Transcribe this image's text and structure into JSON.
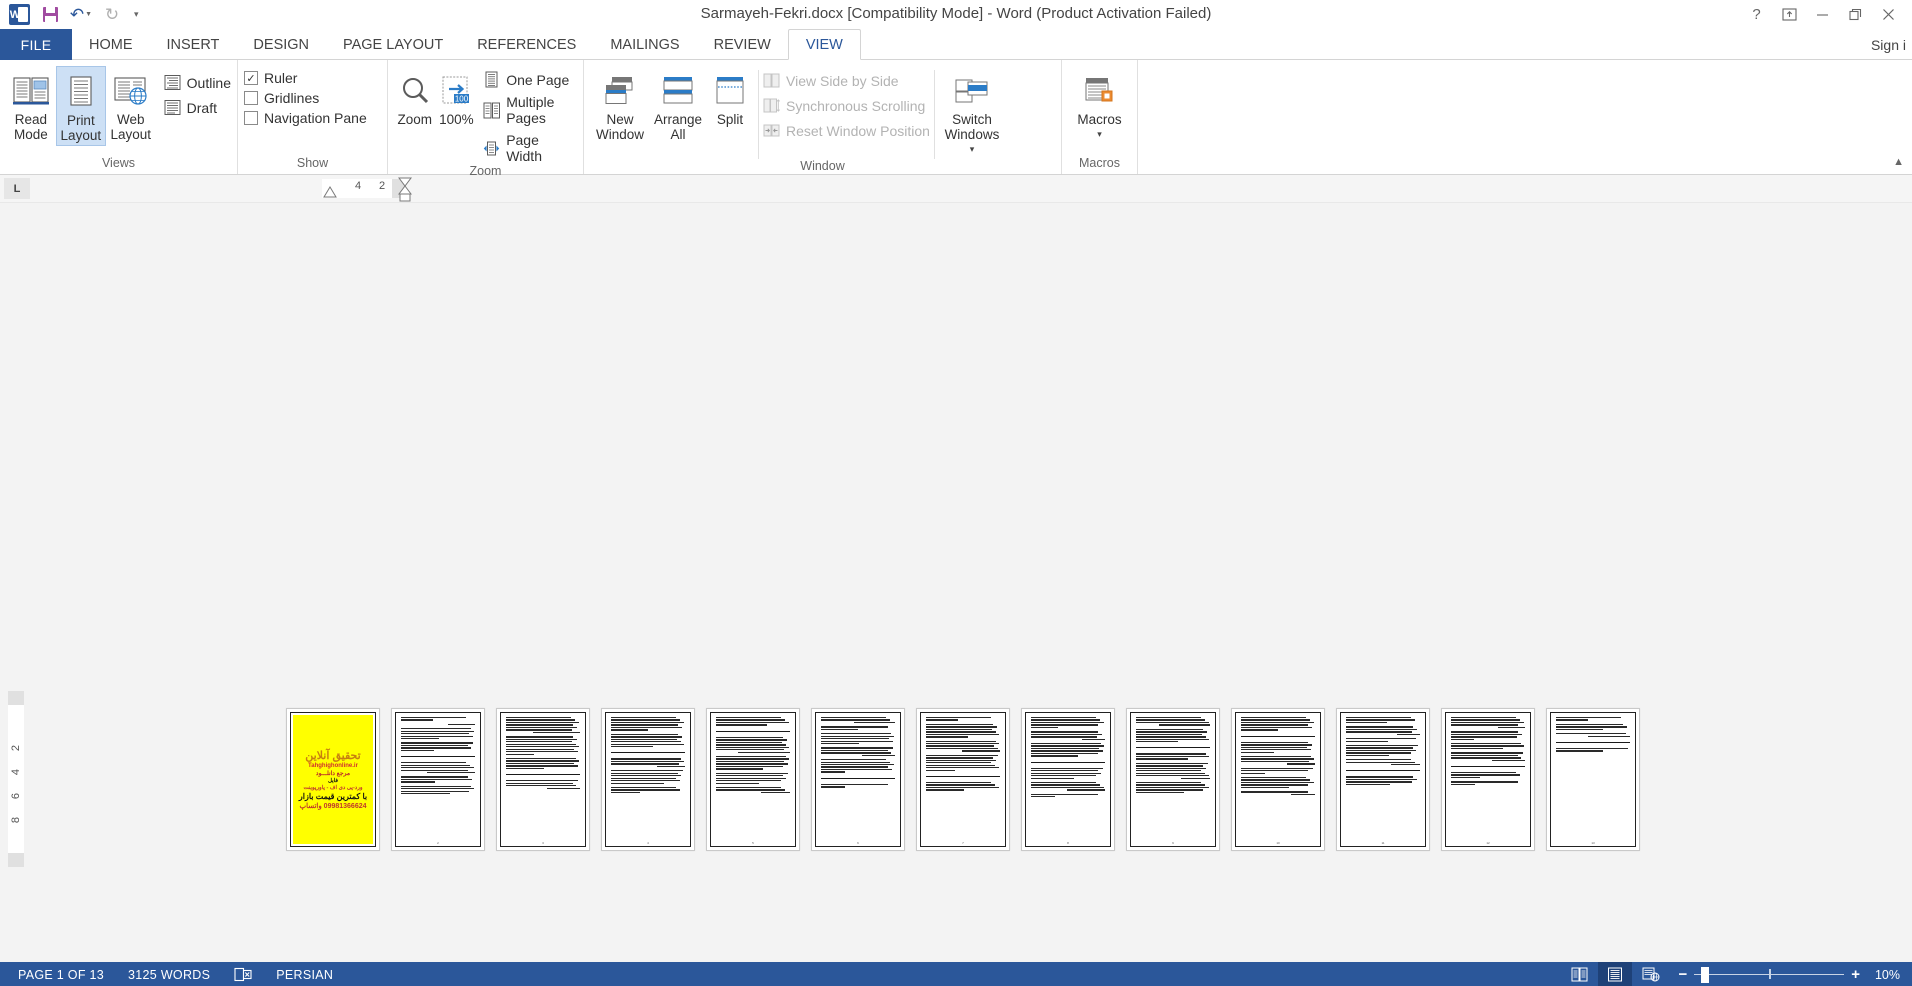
{
  "titlebar": {
    "app_icon": "word-logo-icon",
    "quick_access": [
      {
        "name": "save-button",
        "icon": "save-icon"
      },
      {
        "name": "undo-button",
        "icon": "undo-arrow-icon"
      },
      {
        "name": "redo-button",
        "icon": "redo-arrow-icon"
      },
      {
        "name": "customize-qat-button",
        "icon": "chevron-down-icon"
      }
    ],
    "title": "Sarmayeh-Fekri.docx [Compatibility Mode] - Word (Product Activation Failed)",
    "help_label": "?",
    "ribbon_display_label": "Ribbon Display Options",
    "minimize_label": "Minimize",
    "restore_label": "Restore Down",
    "close_label": "Close"
  },
  "tabs": {
    "file_label": "FILE",
    "items": [
      {
        "label": "HOME",
        "active": false
      },
      {
        "label": "INSERT",
        "active": false
      },
      {
        "label": "DESIGN",
        "active": false
      },
      {
        "label": "PAGE LAYOUT",
        "active": false
      },
      {
        "label": "REFERENCES",
        "active": false
      },
      {
        "label": "MAILINGS",
        "active": false
      },
      {
        "label": "REVIEW",
        "active": false
      },
      {
        "label": "VIEW",
        "active": true
      }
    ],
    "signin_label": "Sign i"
  },
  "ribbon": {
    "groups": {
      "views": {
        "label": "Views",
        "read_mode": "Read Mode",
        "print_layout": "Print Layout",
        "web_layout": "Web Layout",
        "outline": "Outline",
        "draft": "Draft"
      },
      "show": {
        "label": "Show",
        "ruler": "Ruler",
        "ruler_checked": true,
        "gridlines": "Gridlines",
        "gridlines_checked": false,
        "navigation_pane": "Navigation Pane",
        "navigation_pane_checked": false
      },
      "zoom": {
        "label": "Zoom",
        "zoom": "Zoom",
        "hundred": "100%",
        "one_page": "One Page",
        "multiple_pages": "Multiple Pages",
        "page_width": "Page Width"
      },
      "window": {
        "label": "Window",
        "new_window": "New Window",
        "arrange_all": "Arrange All",
        "split": "Split",
        "view_side_by_side": "View Side by Side",
        "synchronous_scrolling": "Synchronous Scrolling",
        "reset_window_position": "Reset Window Position",
        "switch_windows": "Switch Windows"
      },
      "macros": {
        "label": "Macros",
        "macros": "Macros"
      }
    },
    "collapse_label": "Collapse the Ribbon"
  },
  "ruler": {
    "tab_selector": "L",
    "marks": [
      "4",
      "2"
    ],
    "vertical_marks": [
      "2",
      "4",
      "6",
      "8"
    ]
  },
  "document": {
    "cover": {
      "line1": "تحقیق آنلاین",
      "line2": "Tahghighonline.ir",
      "line3": "مرجع دانلـــود",
      "line4": "فایل",
      "line5": "ورد-پی دی اف - پاورپوینت",
      "line6": "با کمترین قیمت بازار",
      "line7": "09981366624 واتساپ"
    },
    "page_count": 13,
    "pages": [
      {
        "n": 1,
        "type": "cover"
      },
      {
        "n": 2,
        "type": "text",
        "bordered": true,
        "paras": [
          2,
          1,
          5,
          4,
          5,
          3,
          4
        ]
      },
      {
        "n": 3,
        "type": "text",
        "bordered": true,
        "paras": [
          7,
          8,
          5,
          4
        ]
      },
      {
        "n": 4,
        "type": "text",
        "bordered": true,
        "paras": [
          6,
          6,
          4,
          6,
          3
        ]
      },
      {
        "n": 5,
        "type": "text",
        "bordered": true,
        "paras": [
          4,
          7,
          6,
          5,
          3
        ]
      },
      {
        "n": 6,
        "type": "text",
        "bordered": true,
        "paras": [
          3,
          2,
          5,
          4,
          6,
          2
        ]
      },
      {
        "n": 7,
        "type": "text",
        "bordered": true,
        "paras": [
          2,
          6,
          5,
          7,
          4
        ]
      },
      {
        "n": 8,
        "type": "text",
        "bordered": true,
        "paras": [
          5,
          4,
          6,
          5,
          4,
          2
        ]
      },
      {
        "n": 9,
        "type": "text",
        "bordered": true,
        "paras": [
          4,
          6,
          3,
          7,
          5
        ]
      },
      {
        "n": 10,
        "type": "text",
        "bordered": true,
        "paras": [
          6,
          5,
          4,
          3,
          5,
          2
        ]
      },
      {
        "n": 11,
        "type": "text",
        "bordered": true,
        "paras": [
          3,
          4,
          2,
          5,
          3,
          4
        ]
      },
      {
        "n": 12,
        "type": "text",
        "bordered": true,
        "paras": [
          5,
          4,
          3,
          4,
          3,
          2
        ]
      },
      {
        "n": 13,
        "type": "text",
        "bordered": true,
        "paras": [
          2,
          3,
          2,
          2
        ]
      }
    ]
  },
  "statusbar": {
    "page_label": "PAGE 1 OF 13",
    "words_label": "3125 WORDS",
    "proofing_icon": "proofing-errors-icon",
    "language_label": "PERSIAN",
    "view_buttons": [
      {
        "name": "read-mode-view-button",
        "icon": "read-mode-icon",
        "active": false
      },
      {
        "name": "print-layout-view-button",
        "icon": "print-layout-icon",
        "active": true
      },
      {
        "name": "web-layout-view-button",
        "icon": "web-layout-icon",
        "active": false
      }
    ],
    "zoom_out_label": "−",
    "zoom_in_label": "+",
    "zoom_level": "10%"
  },
  "colors": {
    "brand_blue": "#2b579a",
    "tab_active_text": "#2b579a",
    "cover_bg": "#ffff00",
    "doc_bg": "#f3f3f3",
    "selected_btn": "#cde0f5"
  }
}
